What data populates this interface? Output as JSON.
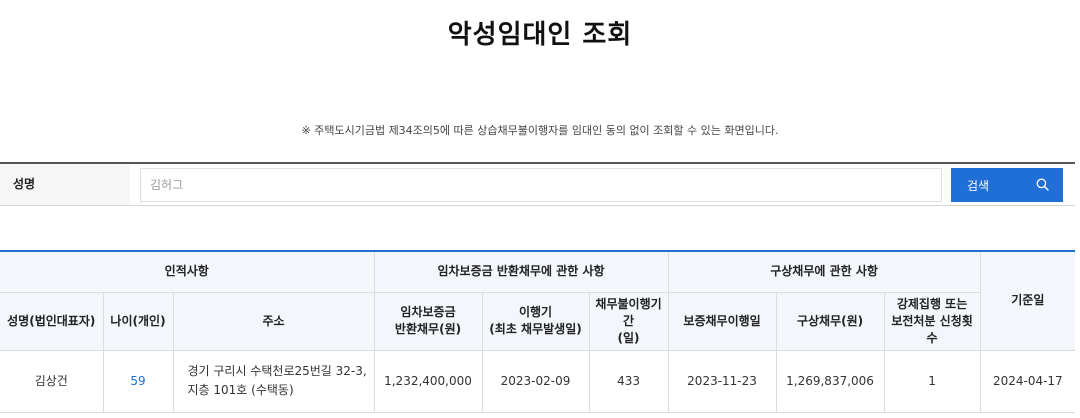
{
  "page": {
    "title": "악성임대인 조회",
    "notice": "※ 주택도시기금법 제34조의5에 따른 상습채무불이행자를 임대인 동의 없이 조회할 수 있는 화면입니다."
  },
  "search": {
    "label": "성명",
    "placeholder": "김허그",
    "button_label": "검색",
    "button_icon": "search-icon",
    "accent_color": "#1f6fd6"
  },
  "table": {
    "group_headers": {
      "personal": "인적사항",
      "deposit": "임차보증금 반환채무에 관한 사항",
      "indemnity": "구상채무에 관한 사항",
      "base_date": "기준일"
    },
    "columns": {
      "name": "성명(법인대표자)",
      "age": "나이(개인)",
      "address": "주소",
      "deposit_debt": "임차보증금\n반환채무(원)",
      "due_date": "이행기\n(최초 채무발생일)",
      "default_period": "채무불이행기간\n(일)",
      "guarantee_date": "보증채무이행일",
      "indemnity_debt": "구상채무(원)",
      "enforcement_count": "강제집행 또는\n보전처분 신청횟수"
    },
    "rows": [
      {
        "name": "김상건",
        "age": "59",
        "address": "경기 구리시 수택천로25번길 32-3,\n지층 101호 (수택동)",
        "deposit_debt": "1,232,400,000",
        "due_date": "2023-02-09",
        "default_period": "433",
        "guarantee_date": "2023-11-23",
        "indemnity_debt": "1,269,837,006",
        "enforcement_count": "1",
        "base_date": "2024-04-17"
      }
    ]
  }
}
